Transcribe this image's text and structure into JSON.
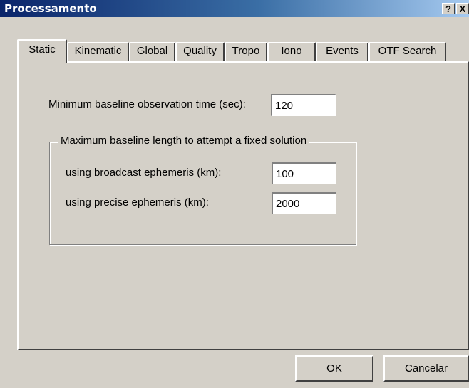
{
  "window": {
    "title": "Processamento",
    "help_label": "?",
    "close_label": "X",
    "title_gradient_start": "#0a246a",
    "title_gradient_end": "#a6caf0"
  },
  "tabs": [
    {
      "label": "Static",
      "active": true
    },
    {
      "label": "Kinematic",
      "active": false
    },
    {
      "label": "Global",
      "active": false
    },
    {
      "label": "Quality",
      "active": false
    },
    {
      "label": "Tropo",
      "active": false
    },
    {
      "label": "Iono",
      "active": false
    },
    {
      "label": "Events",
      "active": false
    },
    {
      "label": "OTF Search",
      "active": false
    }
  ],
  "static": {
    "min_obs_label": "Minimum baseline observation time (sec):",
    "min_obs_value": "120",
    "group_title": "Maximum baseline length to attempt a fixed solution",
    "broadcast_label": "using broadcast ephemeris (km):",
    "broadcast_value": "100",
    "precise_label": "using precise ephemeris (km):",
    "precise_value": "2000"
  },
  "buttons": {
    "ok": "OK",
    "cancel": "Cancelar"
  }
}
